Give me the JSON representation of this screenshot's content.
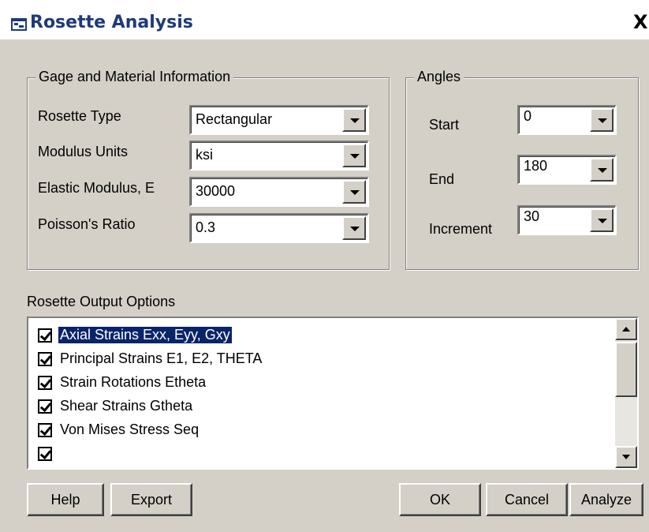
{
  "window": {
    "title": "Rosette Analysis",
    "close_label": "X"
  },
  "gage_group": {
    "legend": "Gage and Material Information",
    "fields": [
      {
        "label": "Rosette Type",
        "value": "Rectangular"
      },
      {
        "label": "Modulus Units",
        "value": "ksi"
      },
      {
        "label": "Elastic Modulus, E",
        "value": "30000"
      },
      {
        "label": "Poisson's Ratio",
        "value": "0.3"
      }
    ]
  },
  "angles_group": {
    "legend": "Angles",
    "fields": [
      {
        "label": "Start",
        "value": "0"
      },
      {
        "label": "End",
        "value": "180"
      },
      {
        "label": "Increment",
        "value": "30"
      }
    ]
  },
  "output": {
    "label": "Rosette Output Options",
    "items": [
      {
        "label": "Axial Strains Exx, Eyy, Gxy",
        "checked": true,
        "selected": true
      },
      {
        "label": "Principal Strains E1, E2, THETA",
        "checked": true
      },
      {
        "label": "Strain Rotations Etheta",
        "checked": true
      },
      {
        "label": "Shear Strains Gtheta",
        "checked": true
      },
      {
        "label": "Von Mises Stress Seq",
        "checked": true
      }
    ]
  },
  "buttons": {
    "help": "Help",
    "export": "Export",
    "ok": "OK",
    "cancel": "Cancel",
    "analyze": "Analyze"
  },
  "colors": {
    "dialog_bg": "#d4d0c8",
    "title_text": "#1d3a7a",
    "selection": "#0a246a"
  }
}
